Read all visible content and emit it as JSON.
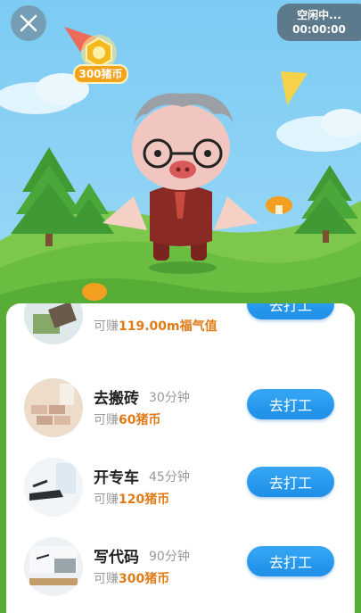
{
  "status": {
    "line1": "空闲中...",
    "timer": "00:00:00"
  },
  "coin_reward": {
    "label": "300猪币"
  },
  "tasks": [
    {
      "title": "",
      "duration": "",
      "earn_prefix": "可赚",
      "earn_value": "119.00m福气值",
      "button": "去打工"
    },
    {
      "title": "去搬砖",
      "duration": "30分钟",
      "earn_prefix": "可赚",
      "earn_value": "60猪币",
      "button": "去打工"
    },
    {
      "title": "开专车",
      "duration": "45分钟",
      "earn_prefix": "可赚",
      "earn_value": "120猪币",
      "button": "去打工"
    },
    {
      "title": "写代码",
      "duration": "90分钟",
      "earn_prefix": "可赚",
      "earn_value": "300猪币",
      "button": "去打工"
    }
  ],
  "colors": {
    "accent_blue": "#2396ec",
    "reward_orange": "#e07c17",
    "grass": "#5db53a",
    "sky": "#8fd3f6"
  }
}
